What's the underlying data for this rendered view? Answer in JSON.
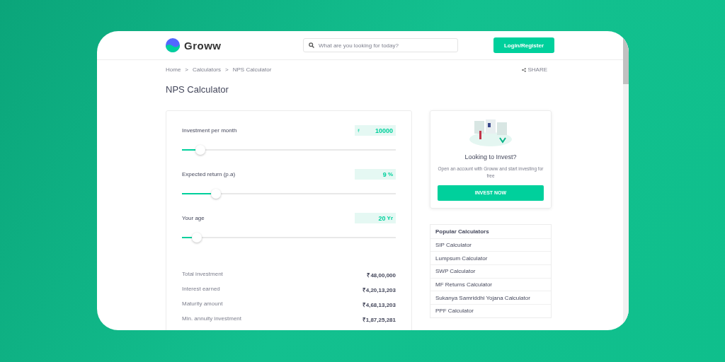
{
  "header": {
    "brand": "Groww",
    "search": {
      "placeholder": "What are you looking for today?"
    },
    "login_button": "Login/Register"
  },
  "breadcrumb": [
    "Home",
    "Calculators",
    "NPS Calculator"
  ],
  "breadcrumb_separator": ">",
  "share": "SHARE",
  "title": "NPS Calculator",
  "inputs": [
    {
      "label": "Investment per month",
      "prefix": "₹",
      "value": "10000",
      "level": 0.085
    },
    {
      "label": "Expected return (p.a)",
      "value": "9",
      "suffix": "%",
      "level": 0.16
    },
    {
      "label": "Your age",
      "value": "20",
      "suffix": "Yr",
      "level": 0.07
    }
  ],
  "results": [
    {
      "label": "Total investment",
      "value": "₹48,00,000"
    },
    {
      "label": "Interest earned",
      "value": "₹4,20,13,203"
    },
    {
      "label": "Maturity amount",
      "value": "₹4,68,13,203"
    },
    {
      "label": "Min. annuity investment",
      "value": "₹1,87,25,281"
    }
  ],
  "invest_card": {
    "heading": "Looking to Invest?",
    "text": "Open an account with Groww and start investing for free",
    "button": "INVEST NOW"
  },
  "popular": {
    "heading": "Popular Calculators",
    "items": [
      "SIP Calculator",
      "Lumpsum Calculator",
      "SWP Calculator",
      "MF Returns Calculator",
      "Sukanya Samriddhi Yojana Calculator",
      "PPF Calculator"
    ]
  }
}
